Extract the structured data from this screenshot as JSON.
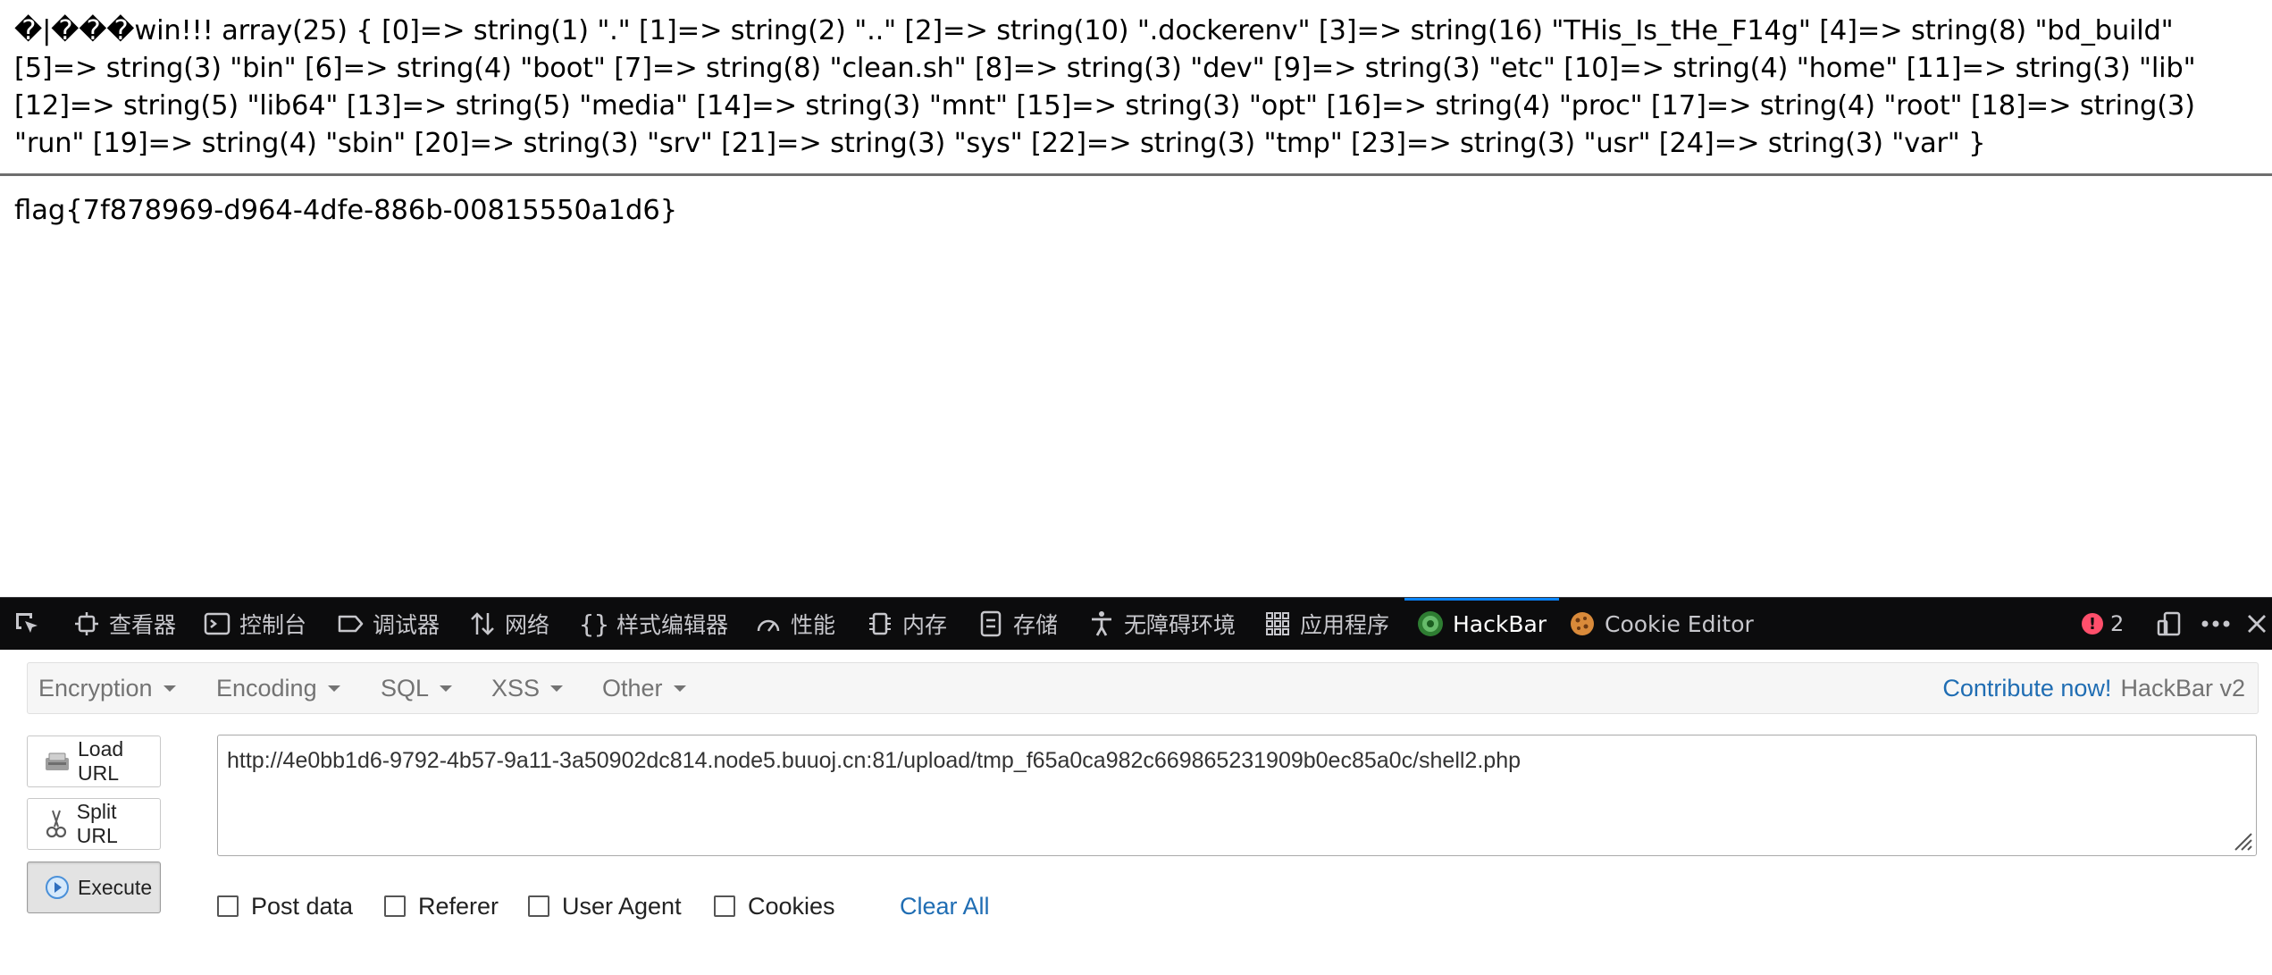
{
  "page": {
    "output_text": "�|���win!!! array(25) { [0]=> string(1) \".\" [1]=> string(2) \"..\" [2]=> string(10) \".dockerenv\" [3]=> string(16) \"THis_Is_tHe_F14g\" [4]=> string(8) \"bd_build\" [5]=> string(3) \"bin\" [6]=> string(4) \"boot\" [7]=> string(8) \"clean.sh\" [8]=> string(3) \"dev\" [9]=> string(3) \"etc\" [10]=> string(4) \"home\" [11]=> string(3) \"lib\" [12]=> string(5) \"lib64\" [13]=> string(5) \"media\" [14]=> string(3) \"mnt\" [15]=> string(3) \"opt\" [16]=> string(4) \"proc\" [17]=> string(4) \"root\" [18]=> string(3) \"run\" [19]=> string(4) \"sbin\" [20]=> string(3) \"srv\" [21]=> string(3) \"sys\" [22]=> string(3) \"tmp\" [23]=> string(3) \"usr\" [24]=> string(3) \"var\" }",
    "flag": "flag{7f878969-d964-4dfe-886b-00815550a1d6}"
  },
  "devtools": {
    "tabs": [
      {
        "label": "查看器",
        "icon": "inspector-icon"
      },
      {
        "label": "控制台",
        "icon": "console-icon"
      },
      {
        "label": "调试器",
        "icon": "debugger-icon"
      },
      {
        "label": "网络",
        "icon": "network-icon"
      },
      {
        "label": "样式编辑器",
        "icon": "style-editor-icon"
      },
      {
        "label": "性能",
        "icon": "performance-icon"
      },
      {
        "label": "内存",
        "icon": "memory-icon"
      },
      {
        "label": "存储",
        "icon": "storage-icon"
      },
      {
        "label": "无障碍环境",
        "icon": "accessibility-icon"
      },
      {
        "label": "应用程序",
        "icon": "application-icon"
      },
      {
        "label": "HackBar",
        "icon": "hackbar-icon"
      },
      {
        "label": "Cookie Editor",
        "icon": "cookie-icon"
      }
    ],
    "selected_tab": "HackBar",
    "error_count": "2",
    "colors": {
      "background": "#0c0c0d",
      "selected_underline": "#0a84ff",
      "error": "#ff4f6b"
    }
  },
  "hackbar": {
    "menu": {
      "encryption": "Encryption",
      "encoding": "Encoding",
      "sql": "SQL",
      "xss": "XSS",
      "other": "Other"
    },
    "contribute": "Contribute now!",
    "version": "HackBar v2",
    "buttons": {
      "load_url": "Load URL",
      "split_url": "Split URL",
      "execute": "Execute"
    },
    "url": "http://4e0bb1d6-9792-4b57-9a11-3a50902dc814.node5.buuoj.cn:81/upload/tmp_f65a0ca982c669865231909b0ec85a0c/shell2.php",
    "options": {
      "post_data": "Post data",
      "referer": "Referer",
      "user_agent": "User Agent",
      "cookies": "Cookies"
    },
    "clear_all": "Clear All",
    "colors": {
      "link": "#1f6db3",
      "menu_text": "#737373"
    }
  }
}
